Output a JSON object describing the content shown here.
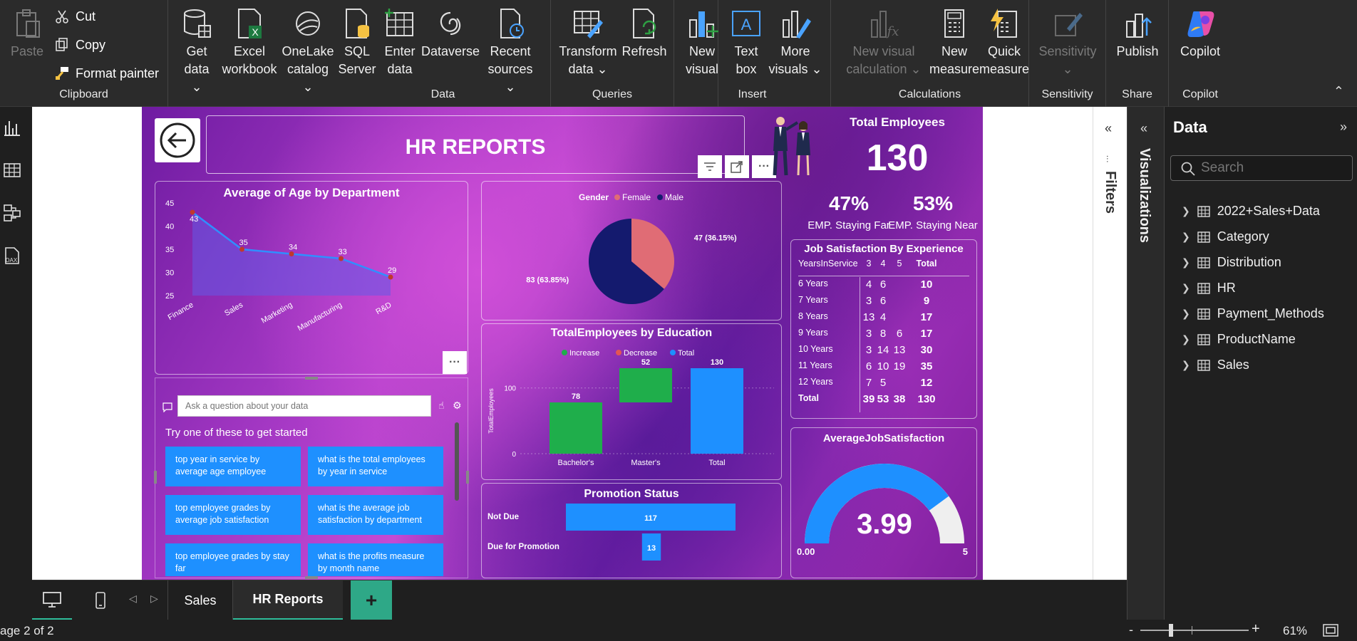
{
  "ribbon": {
    "clipboard": {
      "paste": "Paste",
      "cut": "Cut",
      "copy": "Copy",
      "format_painter": "Format painter",
      "label": "Clipboard"
    },
    "data": {
      "get_data": [
        "Get",
        "data ⌄"
      ],
      "excel": [
        "Excel",
        "workbook"
      ],
      "onelake": [
        "OneLake",
        "catalog ⌄"
      ],
      "sql": [
        "SQL",
        "Server"
      ],
      "enter": [
        "Enter",
        "data"
      ],
      "dataverse": "Dataverse",
      "recent": [
        "Recent",
        "sources ⌄"
      ],
      "label": "Data"
    },
    "queries": {
      "transform": [
        "Transform",
        "data ⌄"
      ],
      "refresh": "Refresh",
      "label": "Queries"
    },
    "insert": {
      "new_visual": [
        "New",
        "visual"
      ],
      "text_box": [
        "Text",
        "box"
      ],
      "more_visuals": [
        "More",
        "visuals ⌄"
      ],
      "label": "Insert"
    },
    "calculations": {
      "new_visual_calc": [
        "New visual",
        "calculation ⌄"
      ],
      "new_measure": [
        "New",
        "measure"
      ],
      "quick_measure": [
        "Quick",
        "measure"
      ],
      "label": "Calculations"
    },
    "sensitivity": {
      "btn": [
        "Sensitivity",
        "⌄"
      ],
      "label": "Sensitivity"
    },
    "share": {
      "publish": "Publish",
      "label": "Share"
    },
    "copilot": {
      "btn": "Copilot",
      "label": "Copilot"
    }
  },
  "report": {
    "title": "HR REPORTS",
    "total_employees_label": "Total Employees",
    "total_employees": "130",
    "staying_far_pct": "47%",
    "staying_far_label": "EMP. Staying Far",
    "staying_near_pct": "53%",
    "staying_near_label": "EMP. Staying Near",
    "age_chart": {
      "title": "Average of Age by Department",
      "categories": [
        "Finance",
        "Sales",
        "Marketing",
        "Manufacturing",
        "R&D"
      ],
      "values": [
        43,
        35,
        34,
        33,
        29
      ],
      "yticks": [
        "45",
        "40",
        "35",
        "30",
        "25"
      ],
      "ylim": [
        25,
        45
      ]
    },
    "gender_chart": {
      "legend_title": "Gender",
      "legend": [
        "Female",
        "Male"
      ],
      "slices": [
        {
          "name": "Female",
          "value": 47,
          "label": "47 (36.15%)",
          "color": "#e06c75"
        },
        {
          "name": "Male",
          "value": 83,
          "label": "83 (63.85%)",
          "color": "#141a6e"
        }
      ]
    },
    "education_chart": {
      "title": "TotalEmployees by Education",
      "legend": [
        "Increase",
        "Decrease",
        "Total"
      ],
      "categories": [
        "Bachelor's",
        "Master's",
        "Total"
      ],
      "values": [
        78,
        52,
        130
      ],
      "ylabel": "TotalEmployees",
      "yticks": [
        "100",
        "0"
      ]
    },
    "promotion_chart": {
      "title": "Promotion Status",
      "categories": [
        "Not Due",
        "Due for Promotion"
      ],
      "values": [
        117,
        13
      ]
    },
    "job_table": {
      "title": "Job Satisfaction By Experience",
      "header": [
        "YearsInService",
        "3",
        "4",
        "5",
        "Total"
      ],
      "rows": [
        [
          "6 Years",
          "4",
          "6",
          "",
          "10"
        ],
        [
          "7 Years",
          "3",
          "6",
          "",
          "9"
        ],
        [
          "8 Years",
          "13",
          "4",
          "",
          "17"
        ],
        [
          "9 Years",
          "3",
          "8",
          "6",
          "17"
        ],
        [
          "10 Years",
          "3",
          "14",
          "13",
          "30"
        ],
        [
          "11 Years",
          "6",
          "10",
          "19",
          "35"
        ],
        [
          "12 Years",
          "7",
          "5",
          "",
          "12"
        ],
        [
          "Total",
          "39",
          "53",
          "38",
          "130"
        ]
      ]
    },
    "gauge": {
      "title": "AverageJobSatisfaction",
      "value": 3.99,
      "value_text": "3.99",
      "min": "0.00",
      "max": "5",
      "min_val": 0,
      "max_val": 5
    },
    "qa": {
      "placeholder": "Ask a question about your data",
      "prompt": "Try one of these to get started",
      "suggestions": [
        "top year in service by average age employee",
        "what is the total employees by year in service",
        "top employee grades by average job satisfaction",
        "what is the average job satisfaction by department",
        "top employee grades by stay far",
        "what is the profits measure by month name"
      ]
    }
  },
  "panes": {
    "filters": "Filters",
    "visualizations": "Visualizations",
    "data": "Data",
    "search_placeholder": "Search",
    "tables": [
      "2022+Sales+Data",
      "Category",
      "Distribution",
      "HR",
      "Payment_Methods",
      "ProductName",
      "Sales"
    ]
  },
  "tabs": {
    "items": [
      "Sales",
      "HR Reports"
    ],
    "add": "+"
  },
  "status": {
    "page": "age 2 of 2",
    "zoom": "61%",
    "minus": "-",
    "plus": "+"
  },
  "colors": {
    "accent": "#1e90ff",
    "green": "#1fae4b",
    "dot": "#c0392b"
  }
}
